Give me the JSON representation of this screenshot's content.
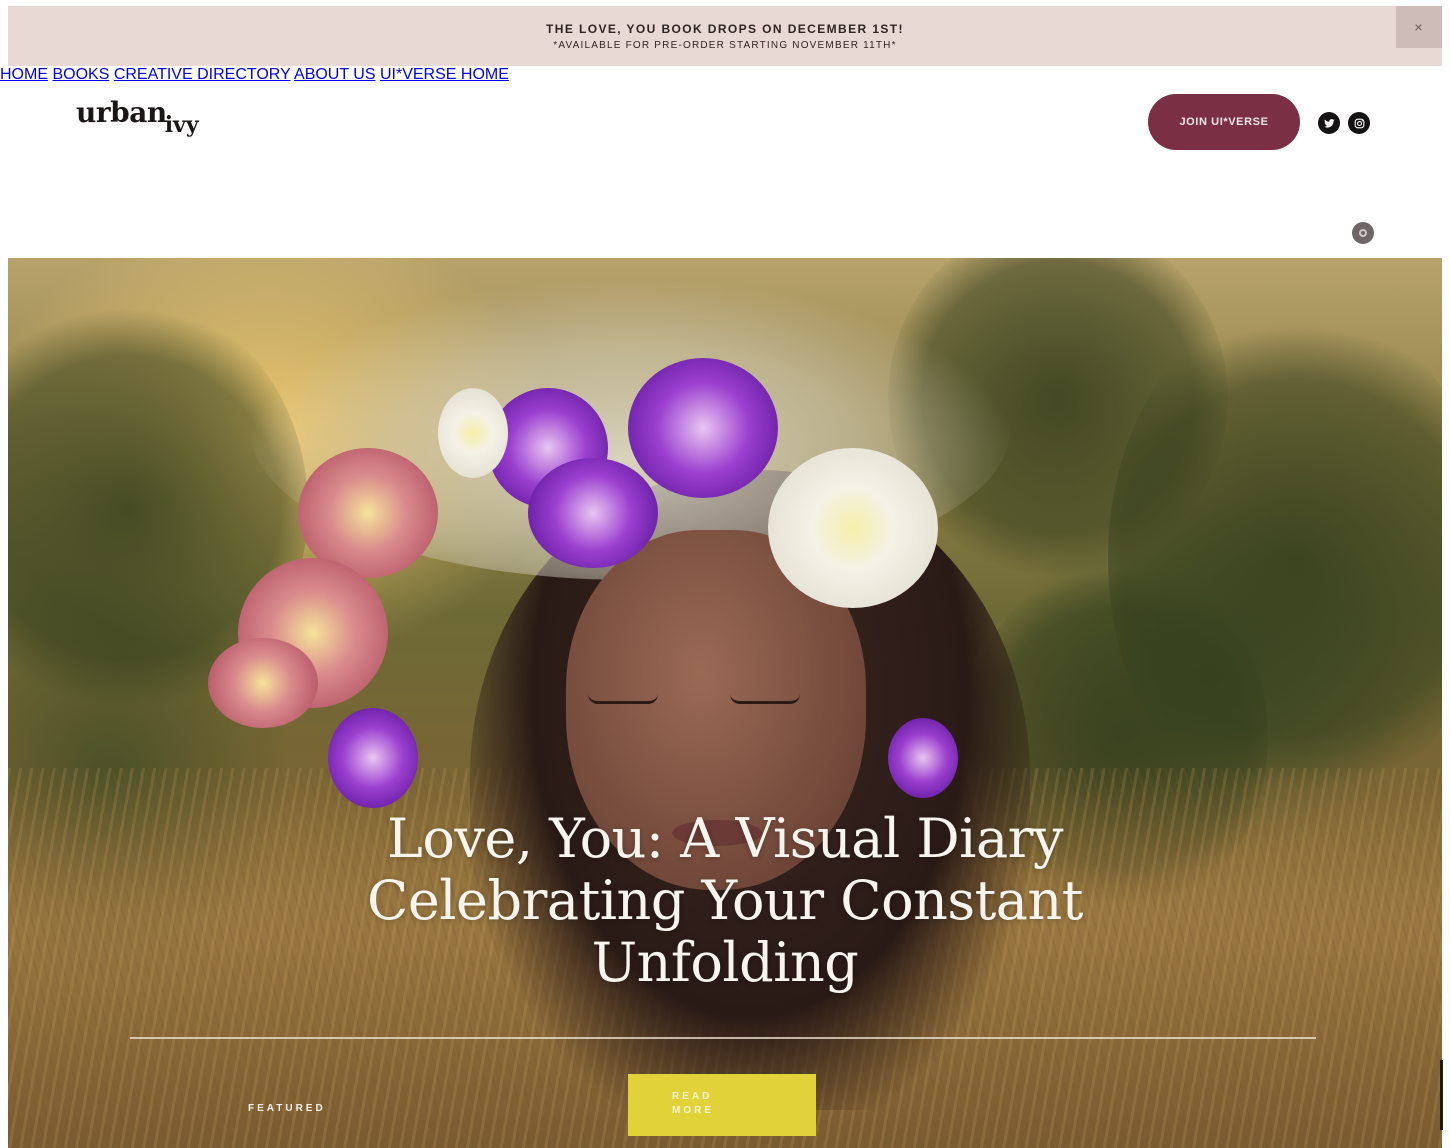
{
  "announcement": {
    "line1": "THE LOVE, YOU BOOK DROPS ON DECEMBER 1ST!",
    "line2": "*AVAILABLE FOR PRE-ORDER STARTING NOVEMBER 11TH*",
    "close_label": "×"
  },
  "header": {
    "logo_main": "urban",
    "logo_sub": "ivy",
    "nav": [
      {
        "label": "HOME"
      },
      {
        "label": "BOOKS"
      },
      {
        "label": "CREATIVE DIRECTORY"
      },
      {
        "label": "ABOUT US"
      },
      {
        "label": "UI*VERSE HOME"
      }
    ],
    "join_label": "JOIN UI*VERSE",
    "social": [
      {
        "icon": "twitter-icon"
      },
      {
        "icon": "instagram-icon"
      }
    ]
  },
  "hero": {
    "title_line1": "Love, You: A Visual Diary",
    "title_line2": "Celebrating Your Constant",
    "title_line3": "Unfolding",
    "featured_label": "FEATURED",
    "read_more_line1": "READ",
    "read_more_line2": "MORE"
  },
  "colors": {
    "announcement_bg": "#e8d9d5",
    "join_button": "#7a2f45",
    "read_more_button": "#e2d23a"
  }
}
